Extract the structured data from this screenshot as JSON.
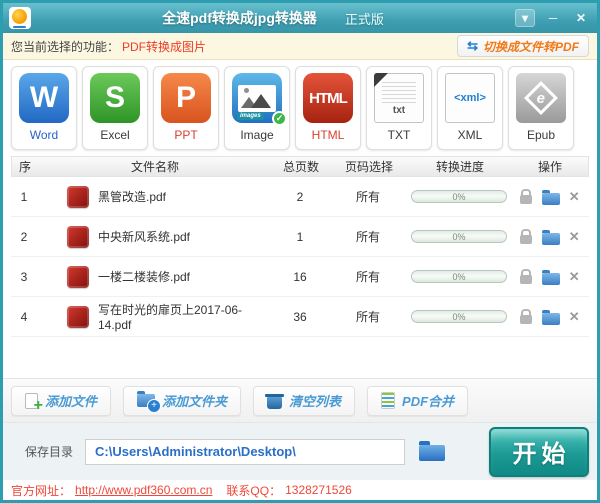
{
  "window": {
    "title": "全速pdf转换成jpg转换器",
    "edition": "正式版",
    "controls": {
      "menu": "▾",
      "minimize": "─",
      "close": "✕"
    }
  },
  "notice": {
    "label": "您当前选择的功能：",
    "value": "PDF转换成图片",
    "switch_icon": "⇆",
    "switch_button": "切换成文件转PDF"
  },
  "formats": [
    {
      "label": "Word",
      "glyph": "W"
    },
    {
      "label": "Excel",
      "glyph": "S"
    },
    {
      "label": "PPT",
      "glyph": "P"
    },
    {
      "label": "Image",
      "badge": "images",
      "check": "✓"
    },
    {
      "label": "HTML",
      "glyph": "HTML"
    },
    {
      "label": "TXT",
      "glyph": "txt"
    },
    {
      "label": "XML",
      "glyph": "<xml>"
    },
    {
      "label": "Epub",
      "glyph": "e"
    }
  ],
  "table": {
    "headers": [
      "序",
      "文件名称",
      "总页数",
      "页码选择",
      "转换进度",
      "操作"
    ],
    "delete_glyph": "✕",
    "rows": [
      {
        "index": "1",
        "name": "黑管改造.pdf",
        "pages": "2",
        "range": "所有",
        "progress": "0%"
      },
      {
        "index": "2",
        "name": "中央新风系统.pdf",
        "pages": "1",
        "range": "所有",
        "progress": "0%"
      },
      {
        "index": "3",
        "name": "一楼二楼装修.pdf",
        "pages": "16",
        "range": "所有",
        "progress": "0%"
      },
      {
        "index": "4",
        "name": "写在时光的扉页上2017-06-14.pdf",
        "pages": "36",
        "range": "所有",
        "progress": "0%"
      }
    ]
  },
  "toolbar": {
    "add_file": "添加文件",
    "add_folder": "添加文件夹",
    "clear_list": "清空列表",
    "pdf_merge": "PDF合并"
  },
  "save": {
    "label": "保存目录",
    "path": "C:\\Users\\Administrator\\Desktop\\",
    "start": "开始"
  },
  "footer": {
    "site_label": "官方网址：",
    "site_url": "http://www.pdf360.com.cn",
    "qq_label": "联系QQ：",
    "qq": "1328271526"
  },
  "colors": {
    "titlebar_teal": "#3e9fb2",
    "notice_yellow": "#fbf7e1",
    "alert_red": "#f03a28",
    "link_blue": "#2a6fc9",
    "toolbar_blue": "#4a9bd5",
    "start_teal": "#16918d"
  }
}
